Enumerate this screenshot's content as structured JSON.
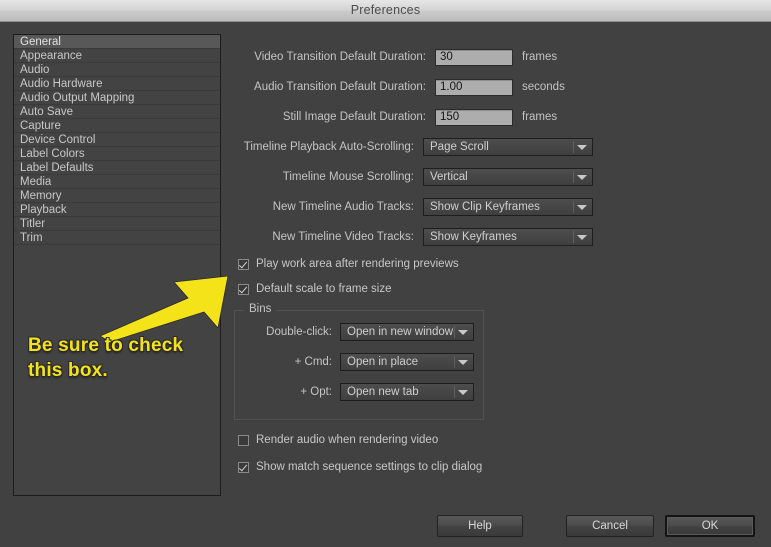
{
  "window": {
    "title": "Preferences"
  },
  "sidebar": {
    "items": [
      {
        "label": "General",
        "selected": true
      },
      {
        "label": "Appearance",
        "selected": false
      },
      {
        "label": "Audio",
        "selected": false
      },
      {
        "label": "Audio Hardware",
        "selected": false
      },
      {
        "label": "Audio Output Mapping",
        "selected": false
      },
      {
        "label": "Auto Save",
        "selected": false
      },
      {
        "label": "Capture",
        "selected": false
      },
      {
        "label": "Device Control",
        "selected": false
      },
      {
        "label": "Label Colors",
        "selected": false
      },
      {
        "label": "Label Defaults",
        "selected": false
      },
      {
        "label": "Media",
        "selected": false
      },
      {
        "label": "Memory",
        "selected": false
      },
      {
        "label": "Playback",
        "selected": false
      },
      {
        "label": "Titler",
        "selected": false
      },
      {
        "label": "Trim",
        "selected": false
      }
    ]
  },
  "general": {
    "video_transition": {
      "label": "Video Transition Default Duration:",
      "value": "30",
      "unit": "frames"
    },
    "audio_transition": {
      "label": "Audio Transition Default Duration:",
      "value": "1.00",
      "unit": "seconds"
    },
    "still_image": {
      "label": "Still Image Default Duration:",
      "value": "150",
      "unit": "frames"
    },
    "auto_scrolling": {
      "label": "Timeline Playback Auto-Scrolling:",
      "value": "Page Scroll"
    },
    "mouse_scrolling": {
      "label": "Timeline Mouse Scrolling:",
      "value": "Vertical"
    },
    "new_audio_tracks": {
      "label": "New Timeline Audio Tracks:",
      "value": "Show Clip Keyframes"
    },
    "new_video_tracks": {
      "label": "New Timeline Video Tracks:",
      "value": "Show Keyframes"
    },
    "play_work_area": {
      "label": "Play work area after rendering previews",
      "checked": true
    },
    "default_scale": {
      "label": "Default scale to frame size",
      "checked": true
    },
    "render_audio": {
      "label": "Render audio when rendering video",
      "checked": false
    },
    "show_match_sequence": {
      "label": "Show match sequence settings to clip dialog",
      "checked": true
    }
  },
  "bins": {
    "legend": "Bins",
    "double_click": {
      "label": "Double-click:",
      "value": "Open in new window"
    },
    "cmd": {
      "label": "+ Cmd:",
      "value": "Open in place"
    },
    "opt": {
      "label": "+ Opt:",
      "value": "Open new tab"
    }
  },
  "footer": {
    "help": "Help",
    "cancel": "Cancel",
    "ok": "OK"
  },
  "annotation": {
    "text": "Be sure to check\nthis box.",
    "color": "#f5e31a"
  }
}
